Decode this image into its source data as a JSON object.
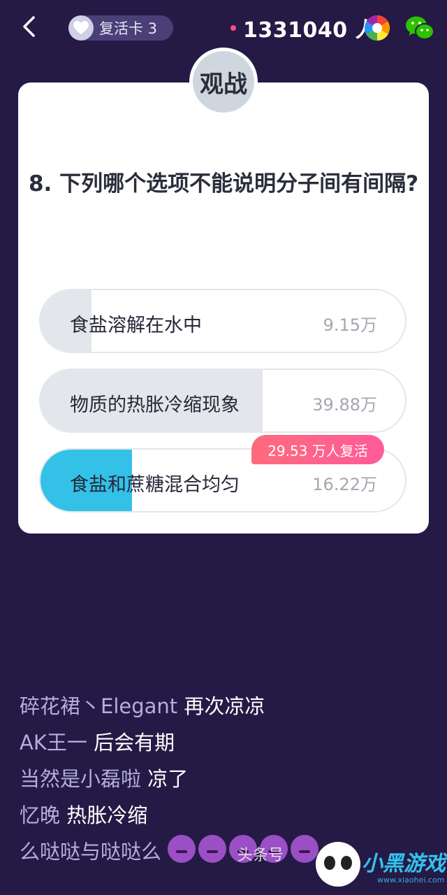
{
  "header": {
    "revive_card": "复活卡 3",
    "online_count": "1331040 人"
  },
  "card": {
    "badge": "观战",
    "question": "8. 下列哪个选项不能说明分子间有间隔?",
    "options": [
      {
        "label": "食盐溶解在水中",
        "count": "9.15万",
        "fraction": 0.14,
        "fill_color": "#e3e6ea"
      },
      {
        "label": "物质的热胀冷缩现象",
        "count": "39.88万",
        "fraction": 0.61,
        "fill_color": "#e3e6ea"
      },
      {
        "label": "食盐和蔗糖混合均匀",
        "count": "16.22万",
        "fraction": 0.25,
        "fill_color": "#33c1e8"
      }
    ],
    "revive_tag": "29.53 万人复活"
  },
  "comments": [
    {
      "user": "碎花裙丶Elegant",
      "msg": "再次凉凉"
    },
    {
      "user": "AK王一",
      "msg": "后会有期"
    },
    {
      "user": "当然是小磊啦",
      "msg": "凉了"
    },
    {
      "user": "忆晚",
      "msg": "热胀冷缩"
    },
    {
      "user": "么哒哒与哒哒么",
      "msg": ""
    }
  ],
  "watermark": "头条号",
  "logo": {
    "title": "小黑游戏",
    "sub": "www.xiaohei.com"
  },
  "colors": {
    "background": "#241a45",
    "accent": "#33c1e8",
    "tag": "#ff5f88"
  }
}
